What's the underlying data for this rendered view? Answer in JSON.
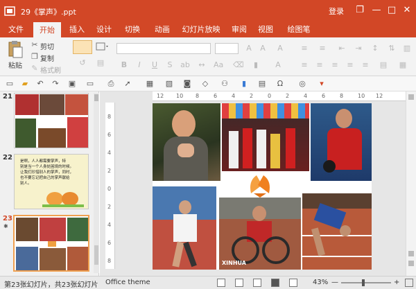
{
  "window": {
    "title": "29《掌声》.ppt",
    "login_label": "登录",
    "minimize": "—",
    "restore": "❐",
    "maximize": "□",
    "close": "✕"
  },
  "tabs": [
    "文件",
    "开始",
    "插入",
    "设计",
    "切换",
    "动画",
    "幻灯片放映",
    "审阅",
    "视图",
    "绘图笔"
  ],
  "active_tab": "开始",
  "ribbon": {
    "paste_label": "粘贴",
    "cut_label": "剪切",
    "copy_label": "复制",
    "format_painter_label": "格式刷"
  },
  "slides": [
    {
      "number": "21"
    },
    {
      "number": "22",
      "text_lines": [
        "是啊，人人都需要掌声，特",
        "别是当一个人身处困境的时候。",
        "让我们珍惜别人的掌声，同时，",
        "也不要忘记把自己的掌声献给",
        "别人。"
      ]
    },
    {
      "number": "23"
    }
  ],
  "status": {
    "slide_info": "第23张幻灯片，共23张幻灯片",
    "theme": "Office theme",
    "zoom": "43%"
  },
  "ruler_marks": {
    "horizontal": [
      "12",
      "10",
      "8",
      "6",
      "4",
      "2",
      "0",
      "2",
      "4",
      "6",
      "8",
      "10",
      "12"
    ],
    "vertical": [
      "8",
      "6",
      "4",
      "2",
      "0",
      "2",
      "4",
      "6",
      "8"
    ]
  },
  "slide_watermark": "XINHUA"
}
